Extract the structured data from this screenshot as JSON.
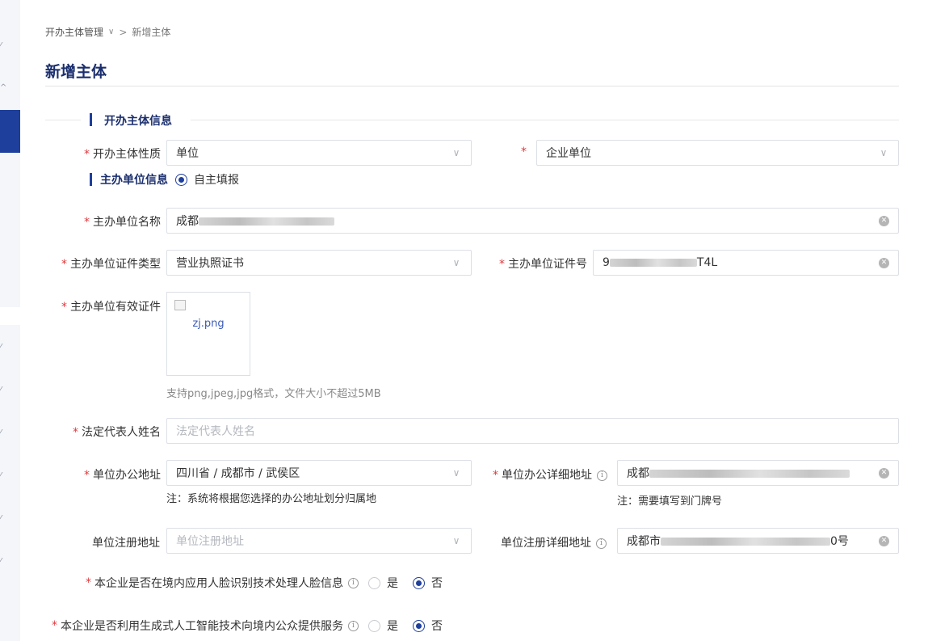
{
  "breadcrumb": {
    "parent": "开办主体管理",
    "parent_caret": "∨",
    "separator": ">",
    "current": "新增主体"
  },
  "page_title": "新增主体",
  "section": {
    "title": "开办主体信息"
  },
  "form": {
    "subject_nature": {
      "label": "开办主体性质",
      "value": "单位",
      "sub_value": "企业单位"
    },
    "sponsor": {
      "heading": "主办单位信息",
      "mode_option": "自主填报",
      "name_label": "主办单位名称",
      "name_value_prefix": "成都",
      "cert_type_label": "主办单位证件类型",
      "cert_type_value": "营业执照证书",
      "cert_no_label": "主办单位证件号",
      "cert_no_prefix": "9",
      "cert_no_suffix": "T4L",
      "valid_cert_label": "主办单位有效证件",
      "upload_filename": "zj.png",
      "upload_hint": "支持png,jpeg,jpg格式，文件大小不超过5MB"
    },
    "legal_rep": {
      "label": "法定代表人姓名",
      "placeholder": "法定代表人姓名"
    },
    "office_address": {
      "label": "单位办公地址",
      "value": "四川省 / 成都市 / 武侯区",
      "note": "注：系统将根据您选择的办公地址划分归属地",
      "detail_label": "单位办公详细地址",
      "detail_value_prefix": "成都",
      "detail_note": "注：需要填写到门牌号"
    },
    "registered_address": {
      "label": "单位注册地址",
      "placeholder": "单位注册地址",
      "detail_label": "单位注册详细地址",
      "detail_value_prefix": "成都市",
      "detail_value_suffix": "0号"
    },
    "face_recognition": {
      "question": "本企业是否在境内应用人脸识别技术处理人脸信息",
      "yes": "是",
      "no": "否",
      "selected": "否"
    },
    "generative_ai": {
      "question": "本企业是否利用生成式人工智能技术向境内公众提供服务",
      "yes": "是",
      "no": "否",
      "selected": "否"
    }
  },
  "icons": {
    "dropdown": "chevron-down-icon",
    "clear": "clear-icon",
    "info": "info-icon"
  },
  "colors": {
    "primary": "#1f3f9c",
    "title": "#1b2f6e",
    "required": "#e0393e",
    "border": "#dcdfe6"
  }
}
